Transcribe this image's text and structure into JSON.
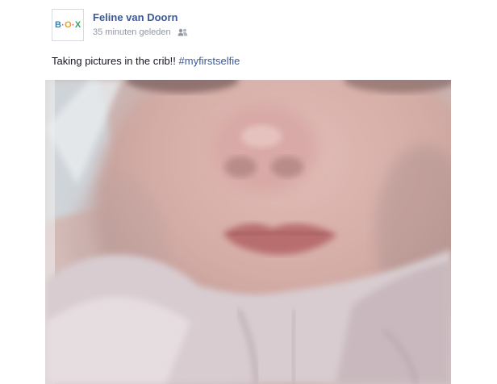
{
  "post": {
    "author": "Feline van Doorn",
    "timestamp": "35 minuten geleden",
    "audience_icon": "friends-icon",
    "avatar": {
      "letters": [
        "B",
        "O",
        "X"
      ],
      "colors": [
        "#2e86c1",
        "#f39c12",
        "#27ae60"
      ]
    },
    "message": "Taking pictures in the crib!!",
    "hashtag": "#myfirstselfie",
    "photo": {
      "subject": "baby-selfie-photo"
    }
  },
  "colors": {
    "link": "#3b5998",
    "meta": "#9197a3",
    "text": "#141823"
  }
}
